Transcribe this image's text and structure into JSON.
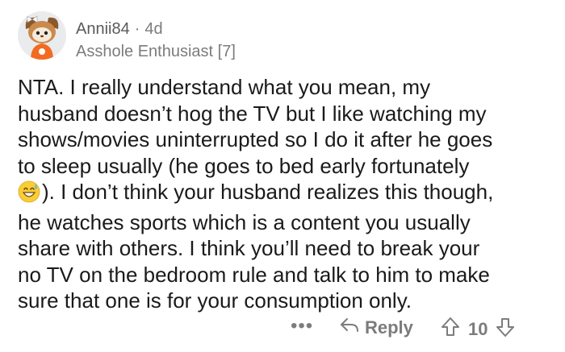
{
  "comment": {
    "username": "Annii84",
    "separator": "·",
    "age": "4d",
    "flair": "Asshole Enthusiast [7]",
    "body_lines": [
      "NTA. I really understand what you mean, my",
      "husband doesn’t hog the TV but I like watching my",
      "shows/movies uninterrupted so I do it after he goes",
      "to sleep usually (he goes to bed early fortunately",
      "). I don’t think your husband realizes this though,",
      "he watches sports which is a content you usually",
      "share with others. I think you’ll need to break your",
      "no TV on the bedroom rule and talk to him to make",
      "sure that one is for your consumption only."
    ],
    "emoji": "grinning-face-with-sweat"
  },
  "actions": {
    "more_label": "•••",
    "reply_label": "Reply",
    "score": "10"
  }
}
